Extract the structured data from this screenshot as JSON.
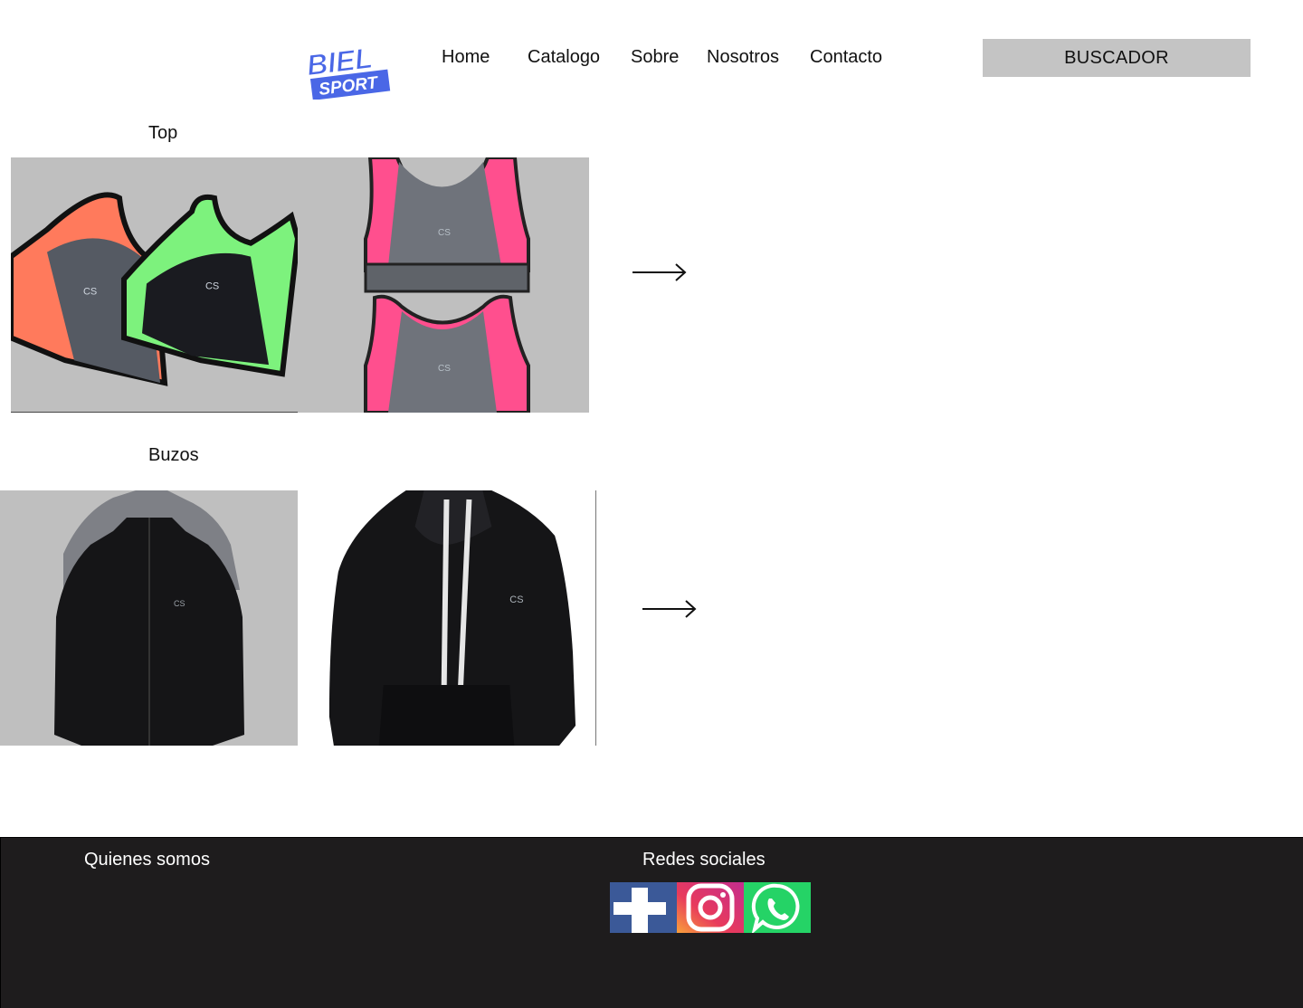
{
  "header": {
    "logo": {
      "line1": "BIEL",
      "line2": "SPORT",
      "color": "#4a67e6"
    },
    "nav": [
      {
        "label": "Home"
      },
      {
        "label": "Catalogo"
      },
      {
        "label": "Sobre"
      },
      {
        "label": "Nosotros"
      },
      {
        "label": "Contacto"
      }
    ],
    "search_label": "BUSCADOR"
  },
  "sections": [
    {
      "title": "Top"
    },
    {
      "title": "Buzos"
    }
  ],
  "footer": {
    "about_title": "Quienes somos",
    "social_title": "Redes sociales",
    "background": "#1e1c1d"
  },
  "social_icons": [
    "facebook-icon",
    "instagram-icon",
    "whatsapp-icon"
  ]
}
